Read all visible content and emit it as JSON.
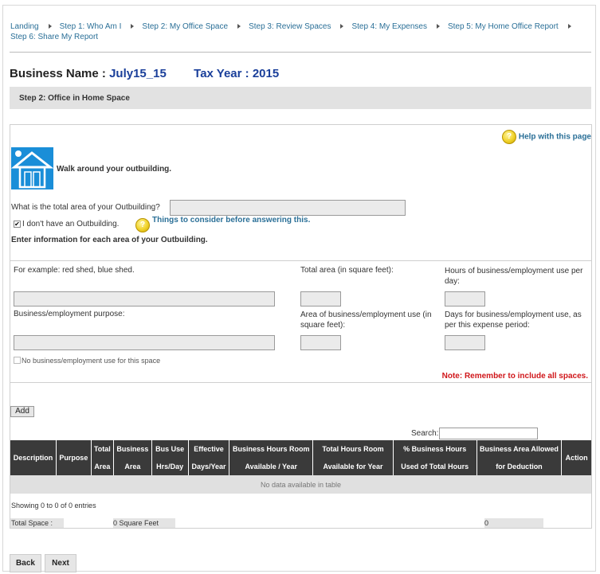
{
  "breadcrumbs": [
    {
      "label": "Landing"
    },
    {
      "label": "Step 1: Who Am I"
    },
    {
      "label": "Step 2: My Office Space"
    },
    {
      "label": "Step 3: Review Spaces"
    },
    {
      "label": "Step 4: My Expenses"
    },
    {
      "label": "Step 5: My Home Office Report"
    },
    {
      "label": "Step 6: Share My Report"
    }
  ],
  "header": {
    "business_label": "Business Name :",
    "business_value": "July15_15",
    "tax_label": "Tax Year :",
    "tax_value": "2015"
  },
  "step_title": "Step 2: Office in Home Space",
  "help_link": "Help with this page",
  "walk_text": "Walk around your outbuilding.",
  "total_area_label": "What is the total area of your Outbuilding?",
  "total_area_value": "",
  "no_outbuilding_label": "I don't have an Outbuilding.",
  "no_outbuilding_checked": true,
  "things_link": "Things to consider before answering this.",
  "enter_info": "Enter information for each area of your Outbuilding.",
  "form": {
    "example_label": "For example: red shed, blue shed.",
    "total_area_sqft_label": "Total area (in square feet):",
    "hours_label": "Hours of business/employment use per day:",
    "purpose_label": "Business/employment purpose:",
    "business_area_label": "Area of business/employment use (in square feet):",
    "days_label": "Days for business/employment use, as per this expense period:",
    "no_use_label": "No business/employment use for this space",
    "note": "Note: Remember to include all spaces."
  },
  "add_button": "Add",
  "search_label": "Search:",
  "search_value": "",
  "table": {
    "columns": [
      "Description",
      "Purpose",
      "Total Area",
      "Business Area",
      "Bus Use Hrs/Day",
      "Effective Days/Year",
      "Business Hours Room Available / Year",
      "Total Hours Room Available for Year",
      "% Business Hours Used of Total Hours",
      "Business Area Allowed for Deduction",
      "Action"
    ],
    "empty_message": "No data available in table",
    "showing": "Showing 0 to 0 of 0 entries"
  },
  "totals": {
    "label": "Total Space :",
    "square_feet": "0 Square Feet",
    "deduction": "0"
  },
  "back_button": "Back",
  "next_button": "Next",
  "colors": {
    "link": "#2a6f97",
    "business_value": "#1a3f9a",
    "note": "#d0161a",
    "table_header": "#3a3a3a",
    "house_icon": "#1a8ed8"
  }
}
